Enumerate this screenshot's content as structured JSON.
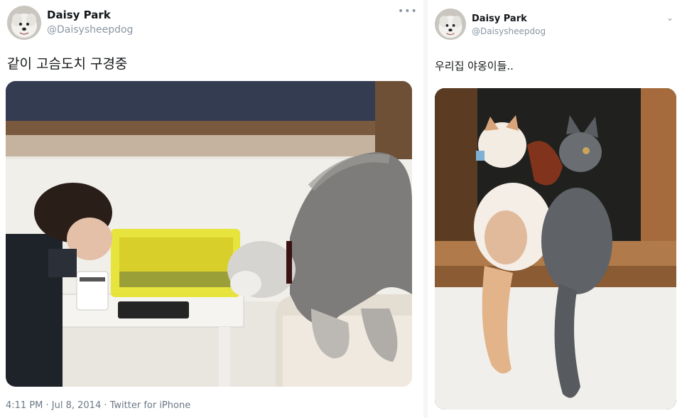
{
  "tweets": [
    {
      "name": "Daisy Park",
      "handle": "@Daisysheepdog",
      "text": "같이 고슴도치 구경중",
      "menu_icon": "more-horizontal-icon",
      "footer": "4:11 PM · Jul 8, 2014 · Twitter for iPhone",
      "media_description_icon": "photo-icon"
    },
    {
      "name": "Daisy Park",
      "handle": "@Daisysheepdog",
      "text": "우리집 야옹이들..",
      "menu_icon": "chevron-down-icon",
      "media_description_icon": "photo-icon"
    }
  ],
  "colors": {
    "name": "#14171a",
    "handle": "#8a96a3",
    "background": "#ffffff",
    "yellow_box": "#e6e22a"
  }
}
